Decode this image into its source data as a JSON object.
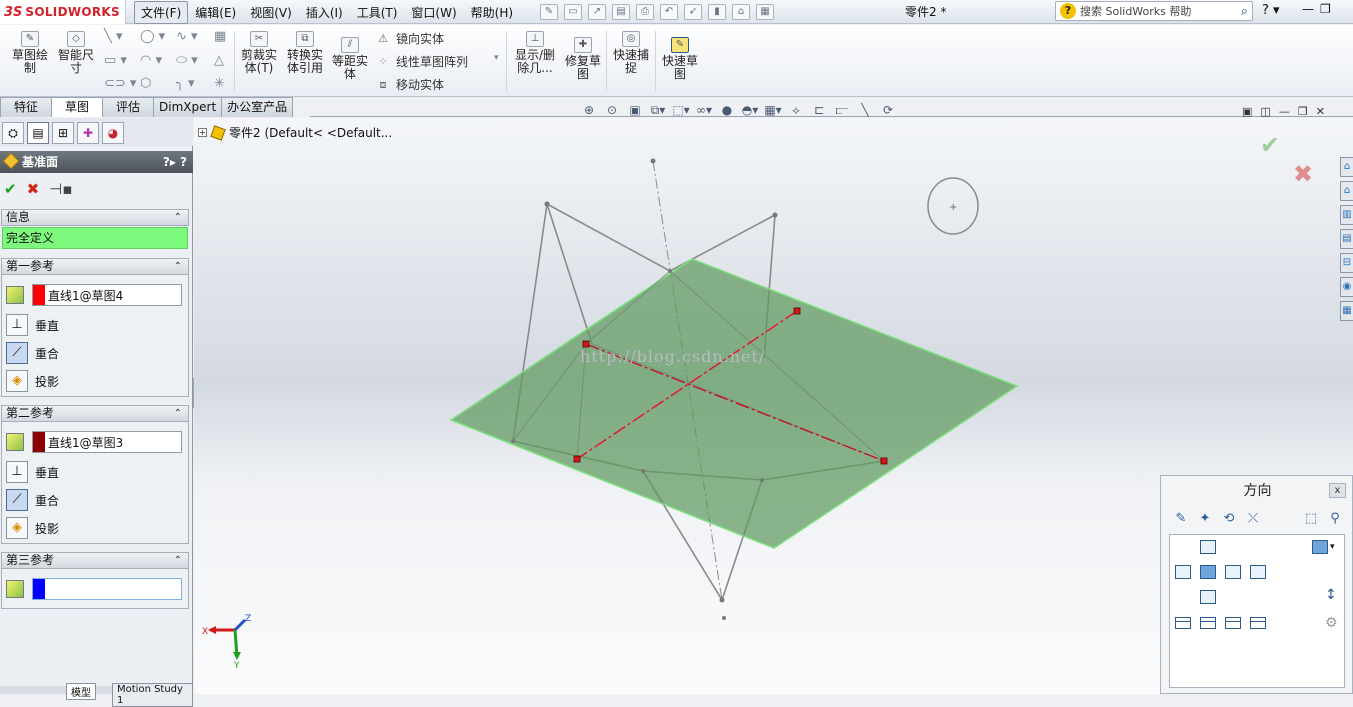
{
  "app": {
    "name": "SOLIDWORKS",
    "doc_title": "零件2 *"
  },
  "menu": [
    "文件(F)",
    "编辑(E)",
    "视图(V)",
    "插入(I)",
    "工具(T)",
    "窗口(W)",
    "帮助(H)"
  ],
  "search": {
    "placeholder": "搜索 SolidWorks 帮助"
  },
  "ribbon": {
    "sketch": "草图绘\n制",
    "smart_dim": "智能尺\n寸",
    "trim": "剪裁实\n体(T)",
    "convert": "转换实\n体引用",
    "offset": "等距实\n体",
    "mirror": "镜向实体",
    "linear_pattern": "线性草图阵列",
    "move": "移动实体",
    "show_delete": "显示/删\n除几...",
    "repair": "修复草\n图",
    "quick_snap": "快速捕\n捉",
    "quick_sketch": "快速草\n图"
  },
  "tabs": [
    "特征",
    "草图",
    "评估",
    "DimXpert",
    "办公室产品"
  ],
  "active_tab": "草图",
  "panel": {
    "title": "基准面",
    "info_header": "信息",
    "status": "完全定义",
    "ref1": {
      "header": "第一参考",
      "value": "直线1@草图4",
      "color": "#ff0000"
    },
    "ref2": {
      "header": "第二参考",
      "value": "直线1@草图3",
      "color": "#8b0000"
    },
    "ref3": {
      "header": "第三参考",
      "value": "",
      "color": "#0000ff"
    },
    "opt_perp": "垂直",
    "opt_coinc": "重合",
    "opt_proj": "投影"
  },
  "tree": {
    "label": "零件2  (Default< <Default..."
  },
  "watermark": "http://blog.csdn.net/",
  "triad": {
    "x": "X",
    "y": "Y",
    "z": "Z"
  },
  "orientation": {
    "title": "方向"
  },
  "bottom_tabs": [
    "模型",
    "Motion Study 1"
  ],
  "colors": {
    "plane": "#6fa86f",
    "accent_red": "#d2232a",
    "status_green": "#7dfa7d"
  }
}
